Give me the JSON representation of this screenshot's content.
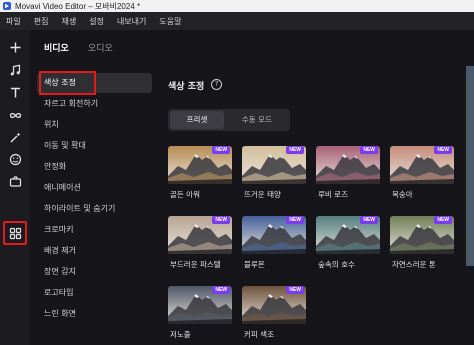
{
  "window": {
    "title": "Movavi Video Editor – 모바비2024 *"
  },
  "menu": [
    "파일",
    "편집",
    "재생",
    "설정",
    "내보내기",
    "도움말"
  ],
  "toolbar": [
    {
      "name": "add-icon",
      "active": false
    },
    {
      "name": "music-icon",
      "active": false
    },
    {
      "name": "text-icon",
      "active": false
    },
    {
      "name": "transition-icon",
      "active": false
    },
    {
      "name": "magic-icon",
      "active": false
    },
    {
      "name": "sticker-icon",
      "active": false
    },
    {
      "name": "camera-icon",
      "active": false
    },
    {
      "name": "apps-icon",
      "active": true
    }
  ],
  "tabs": {
    "video": "비디오",
    "audio": "오디오"
  },
  "categories": [
    "색상 조정",
    "자르고 회전하기",
    "위치",
    "이동 및 확대",
    "안정화",
    "애니메이션",
    "하이라이트 및 숨기기",
    "크로마키",
    "배경 제거",
    "장면 감지",
    "로고타입",
    "느린 화면"
  ],
  "active_category": "색상 조정",
  "panel": {
    "title": "색상 조정",
    "help": "?",
    "mode_preset": "프리셋",
    "mode_manual": "수동 모드",
    "badge": "NEW"
  },
  "presets": [
    {
      "label": "골든 아워",
      "tint": "#c89a5a",
      "new": true
    },
    {
      "label": "뜨거운 태양",
      "tint": "#e8d0a8",
      "new": true
    },
    {
      "label": "루비 로즈",
      "tint": "#b86a80",
      "new": true
    },
    {
      "label": "복숭아",
      "tint": "#d89a86",
      "new": true
    },
    {
      "label": "부드러운 파스텔",
      "tint": "#c8b4a0",
      "new": true
    },
    {
      "label": "블루몬",
      "tint": "#4a6aa8",
      "new": true
    },
    {
      "label": "숲속의 호수",
      "tint": "#5a8a8a",
      "new": true
    },
    {
      "label": "자연스러운 톤",
      "tint": "#7a8a60",
      "new": true
    },
    {
      "label": "저노출",
      "tint": "#556070",
      "new": true
    },
    {
      "label": "커피 색조",
      "tint": "#7a5a40",
      "new": true
    }
  ]
}
